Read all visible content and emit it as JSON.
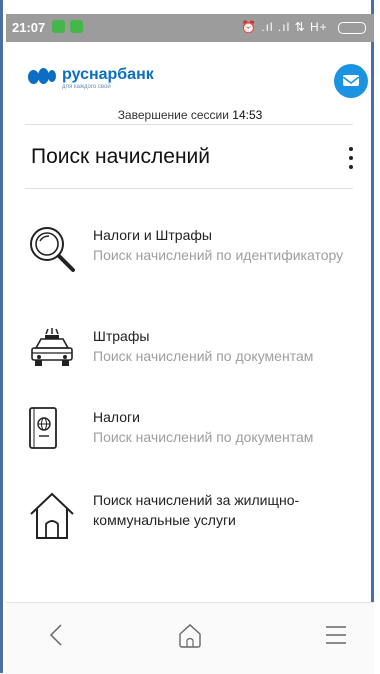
{
  "status": {
    "time": "21:07",
    "right_text": "⏰ .ıl .ıl ⇅ H+"
  },
  "header": {
    "brand": "руснарбанк",
    "tagline": "для каждого свой",
    "session_label": "Завершение сессии",
    "session_time": "14:53"
  },
  "page": {
    "title": "Поиск начислений"
  },
  "items": [
    {
      "title": "Налоги и Штрафы",
      "subtitle": "Поиск начислений по идентификатору",
      "icon": "magnifier-icon"
    },
    {
      "title": "Штрафы",
      "subtitle": "Поиск начислений по документам",
      "icon": "police-car-icon"
    },
    {
      "title": "Налоги",
      "subtitle": "Поиск начислений по документам",
      "icon": "passport-icon"
    },
    {
      "title": "Поиск начислений за жилищно-коммунальные услуги",
      "subtitle": "",
      "icon": "house-icon"
    }
  ],
  "colors": {
    "brand": "#0a6fc4",
    "mail_button": "#1a94e0",
    "statusbar": "#9c9c9c"
  }
}
